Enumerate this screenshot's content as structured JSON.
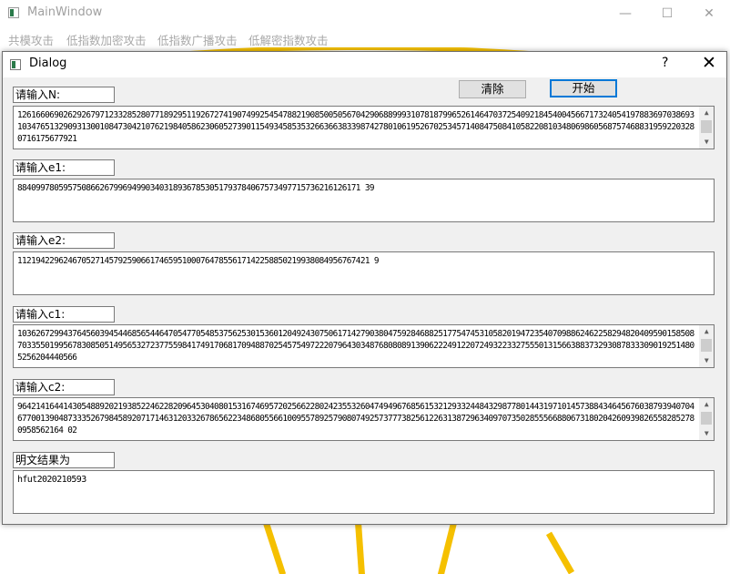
{
  "main_window": {
    "title": "MainWindow",
    "controls": {
      "minimize": "—",
      "maximize": "☐",
      "close": "✕"
    },
    "menu": [
      "共模攻击",
      "低指数加密攻击",
      "低指数广播攻击",
      "低解密指数攻击"
    ]
  },
  "dialog": {
    "title": "Dialog",
    "help": "?",
    "close": "✕",
    "buttons": {
      "clear": "清除",
      "start": "开始"
    },
    "fields": [
      {
        "label": "请输入N:",
        "value": "126166069026292679712332852807718929511926727419074992545478821908500505670429068899931078187996526146470372540921845400456671732405419788369703869310347651329093130010847304210762198405862306052739011549345853532663663833987427801061952670253457140847508410582208103480698605687574688319592203280716175677921",
        "scroll": true
      },
      {
        "label": "请输入e1:",
        "value": "884099780595750866267996949903403189367853051793784067573497715736216126171 39",
        "scroll": false
      },
      {
        "label": "请输入e2:",
        "value": "11219422962467052714579259066174659510007647855617142258850219938084956767421 9",
        "scroll": false
      },
      {
        "label": "请输入c1:",
        "value": "103626729943764560394544685654464705477054853756253015360120492430750617142790380475928468825177547453105820194723540709886246225829482040959015850870335501995678308505149565327237755984174917068170948870254575497222079643034876808089139062224912207249322332755501315663883732930878333090192514805256204440566",
        "scroll": true
      },
      {
        "label": "请输入c2:",
        "value": "964214164414305488920219385224622820964530408015316746957202566228024235532604749496768561532129332448432987780144319710145738843464567603879394070467700139048733352679845892071714631203326786562234868055661009557892579080749257377738256122631387296340970735028555668806731802042609398265582852780958562164 02",
        "scroll": true
      },
      {
        "label": "明文结果为",
        "value": "hfut2020210593",
        "scroll": false
      }
    ]
  }
}
